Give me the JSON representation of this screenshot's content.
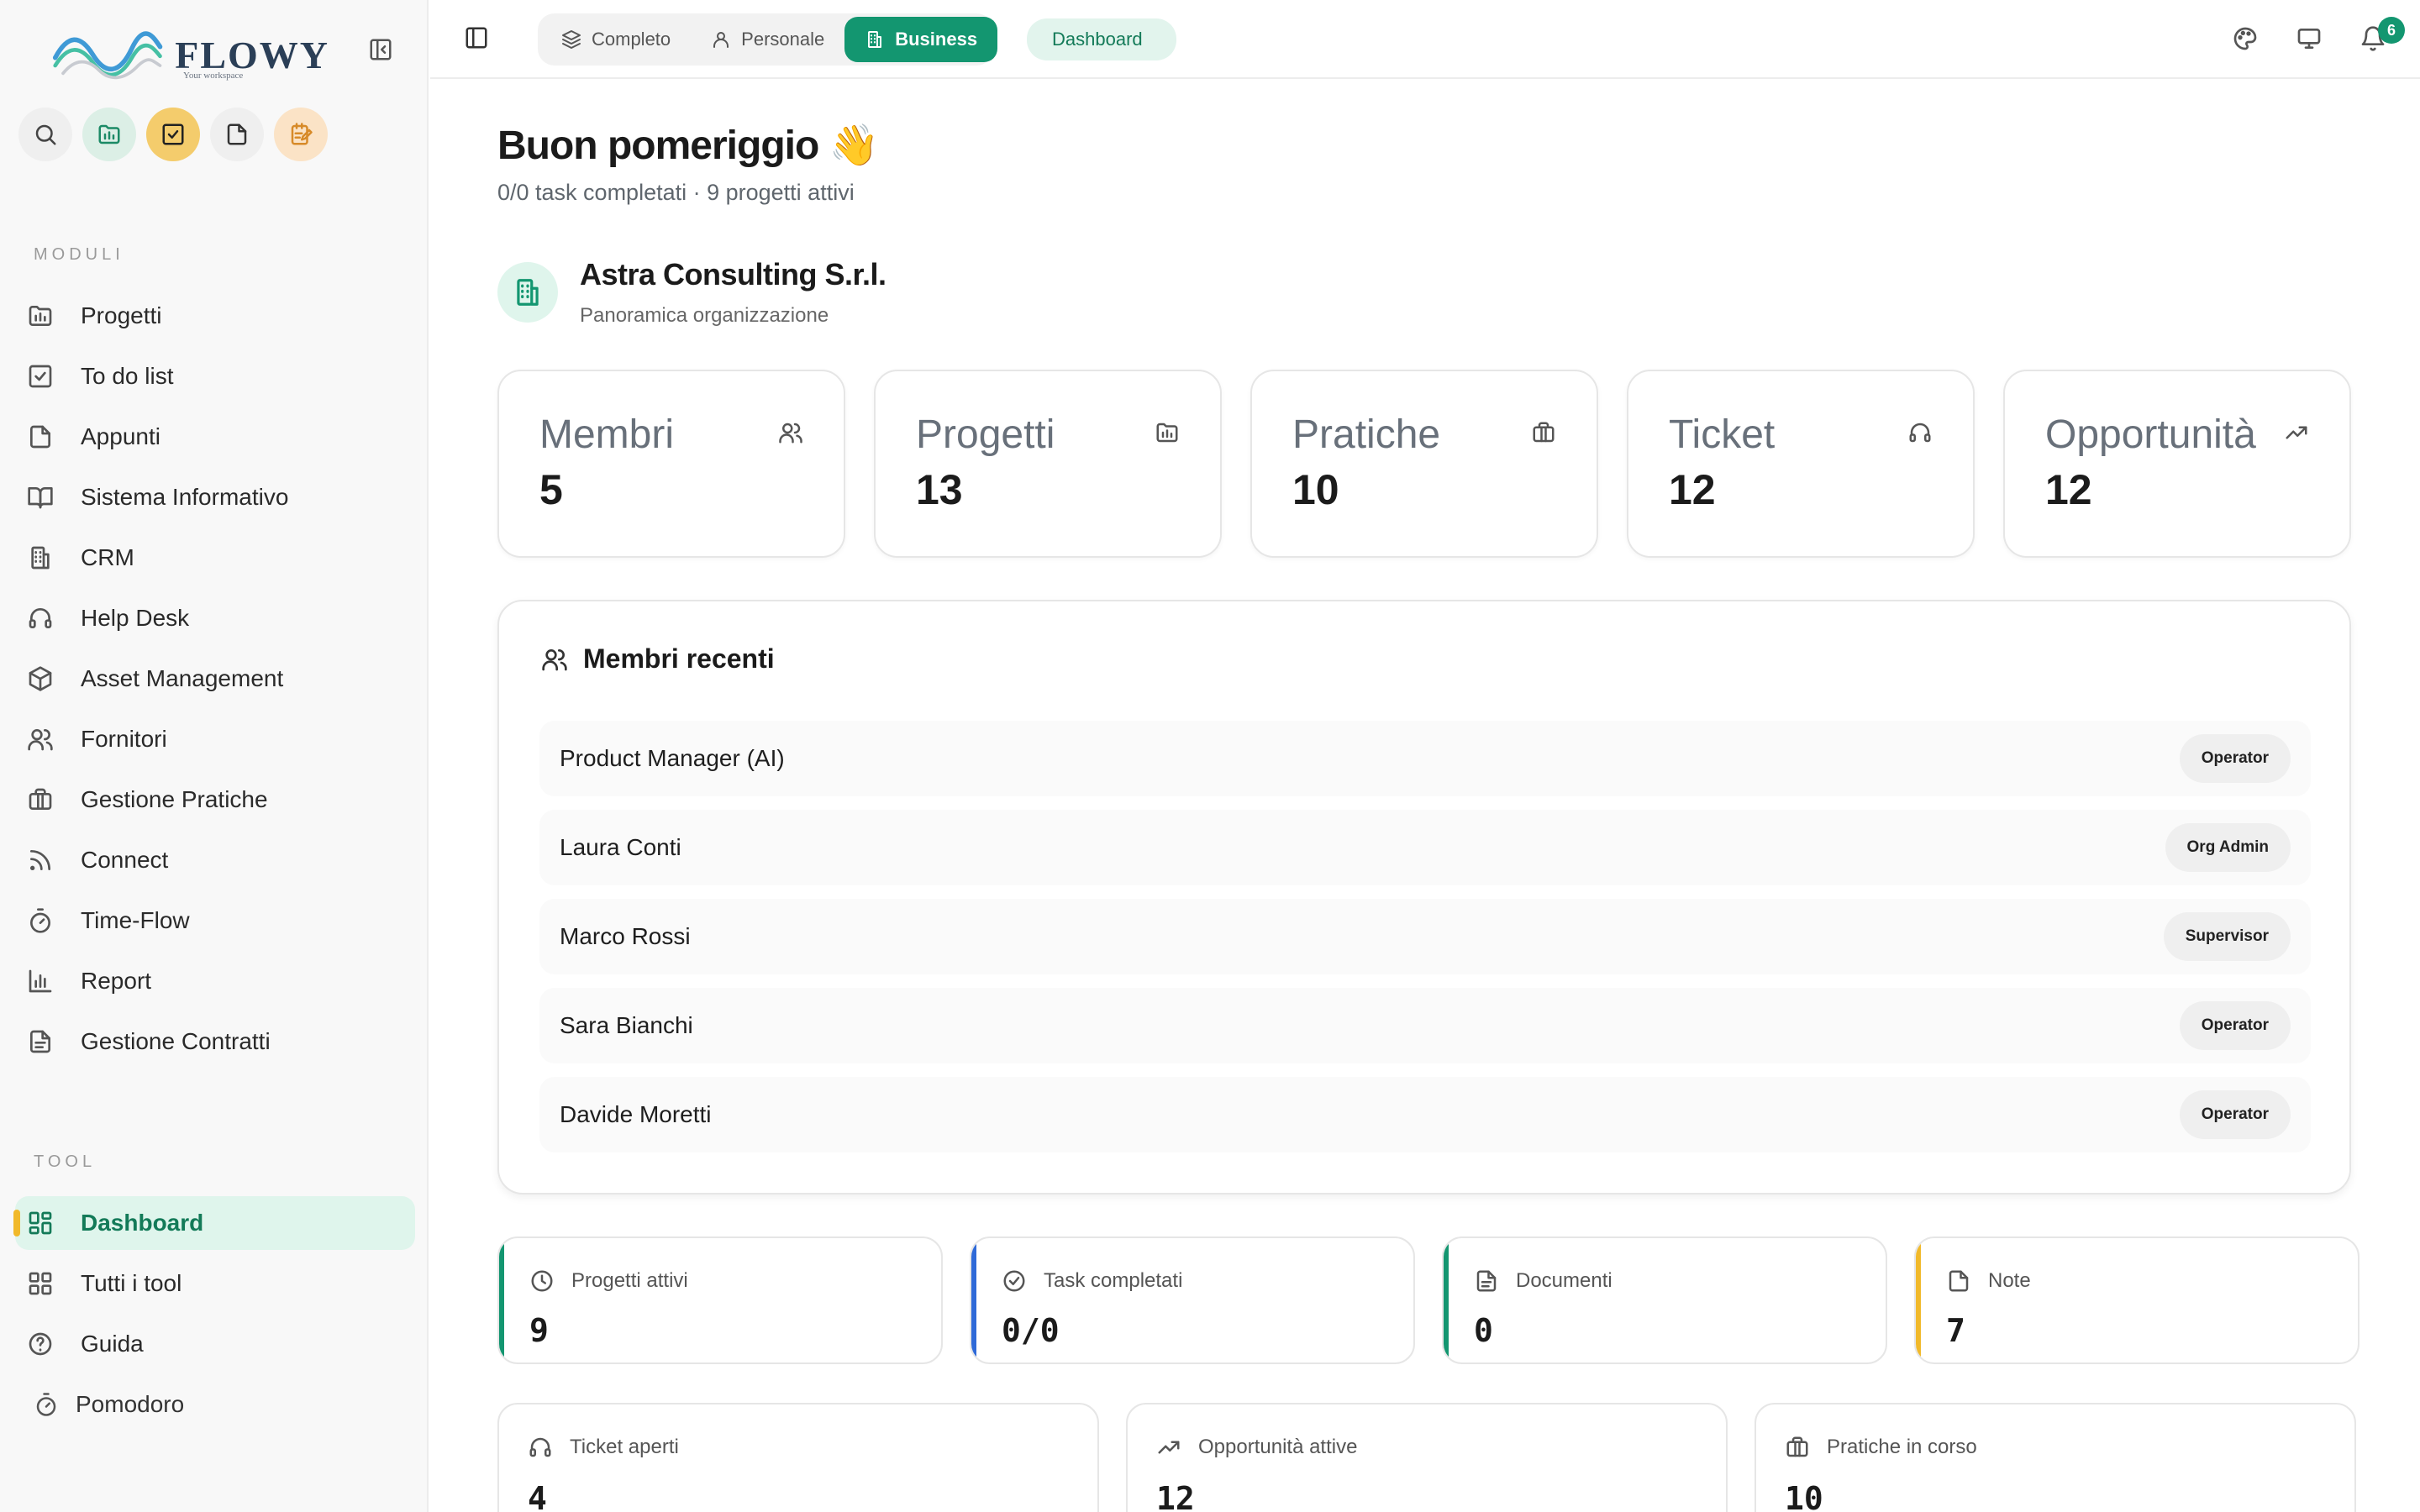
{
  "brand": {
    "name": "FLOWY",
    "tagline": "Your workspace",
    "colors": {
      "primary": "#139670",
      "accent": "#f1b92a"
    }
  },
  "sidebar": {
    "quick_actions": [
      {
        "icon": "search-icon"
      },
      {
        "icon": "projects-icon"
      },
      {
        "icon": "todo-icon"
      },
      {
        "icon": "note-icon"
      },
      {
        "icon": "edit-note-icon"
      }
    ],
    "modules_label": "MODULI",
    "modules": [
      {
        "label": "Progetti",
        "icon": "folder-chart-icon"
      },
      {
        "label": "To do list",
        "icon": "checkbox-icon"
      },
      {
        "label": "Appunti",
        "icon": "file-icon"
      },
      {
        "label": "Sistema Informativo",
        "icon": "book-icon"
      },
      {
        "label": "CRM",
        "icon": "building-icon"
      },
      {
        "label": "Help Desk",
        "icon": "headset-icon"
      },
      {
        "label": "Asset Management",
        "icon": "box-icon"
      },
      {
        "label": "Fornitori",
        "icon": "users-icon"
      },
      {
        "label": "Gestione Pratiche",
        "icon": "briefcase-icon"
      },
      {
        "label": "Connect",
        "icon": "rss-icon"
      },
      {
        "label": "Time-Flow",
        "icon": "timer-icon"
      },
      {
        "label": "Report",
        "icon": "bar-chart-icon"
      },
      {
        "label": "Gestione Contratti",
        "icon": "document-icon"
      }
    ],
    "tools_label": "TOOL",
    "tools": [
      {
        "label": "Dashboard",
        "icon": "dashboard-icon",
        "active": true
      },
      {
        "label": "Tutti i tool",
        "icon": "grid-icon"
      },
      {
        "label": "Guida",
        "icon": "help-icon"
      }
    ],
    "pomodoro": "Pomodoro"
  },
  "topbar": {
    "modes": [
      {
        "label": "Completo",
        "icon": "layers-icon"
      },
      {
        "label": "Personale",
        "icon": "user-icon"
      },
      {
        "label": "Business",
        "icon": "building-icon",
        "active": true
      }
    ],
    "breadcrumb": "Dashboard",
    "notifications_count": "6"
  },
  "main": {
    "greeting": "Buon pomeriggio",
    "greeting_emoji": "👋",
    "subline": "0/0 task completati · 9 progetti attivi",
    "org": {
      "name": "Astra Consulting S.r.l.",
      "subtitle": "Panoramica organizzazione"
    },
    "stats": [
      {
        "title": "Membri",
        "value": "5",
        "icon": "users-icon"
      },
      {
        "title": "Progetti",
        "value": "13",
        "icon": "folder-chart-icon"
      },
      {
        "title": "Pratiche",
        "value": "10",
        "icon": "briefcase-icon"
      },
      {
        "title": "Ticket",
        "value": "12",
        "icon": "headset-icon"
      },
      {
        "title": "Opportunità",
        "value": "12",
        "icon": "trending-up-icon"
      }
    ],
    "recent_members": {
      "title": "Membri recenti",
      "items": [
        {
          "name": "Product Manager (AI)",
          "role": "Operator"
        },
        {
          "name": "Laura Conti",
          "role": "Org Admin"
        },
        {
          "name": "Marco Rossi",
          "role": "Supervisor"
        },
        {
          "name": "Sara Bianchi",
          "role": "Operator"
        },
        {
          "name": "Davide Moretti",
          "role": "Operator"
        }
      ]
    },
    "summary": [
      {
        "label": "Progetti attivi",
        "value": "9",
        "icon": "clock-icon",
        "accent": "#139670"
      },
      {
        "label": "Task completati",
        "value": "0/0",
        "icon": "check-circle-icon",
        "accent": "#2f6ad8"
      },
      {
        "label": "Documenti",
        "value": "0",
        "icon": "document-icon",
        "accent": "#139670"
      },
      {
        "label": "Note",
        "value": "7",
        "icon": "note-icon",
        "accent": "#f1b92a"
      }
    ],
    "summary2": [
      {
        "label": "Ticket aperti",
        "value": "4",
        "icon": "headset-icon"
      },
      {
        "label": "Opportunità attive",
        "value": "12",
        "icon": "trending-up-icon"
      },
      {
        "label": "Pratiche in corso",
        "value": "10",
        "icon": "briefcase-icon"
      }
    ]
  }
}
